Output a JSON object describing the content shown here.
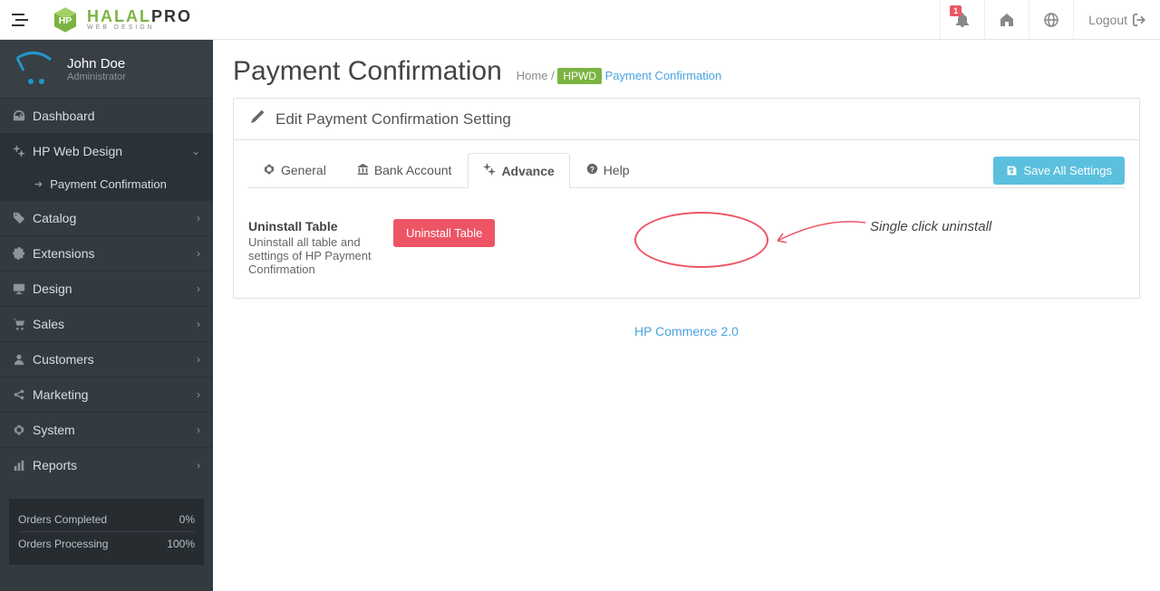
{
  "brand": {
    "main_a": "HALAL",
    "main_b": "PRO",
    "sub": "WEB DESIGN"
  },
  "topbar": {
    "notify_badge": "1",
    "logout": "Logout"
  },
  "user": {
    "name": "John Doe",
    "role": "Administrator"
  },
  "sidebar": {
    "items": [
      {
        "icon": "dashboard",
        "label": "Dashboard"
      },
      {
        "icon": "cogs",
        "label": "HP Web Design",
        "expanded": true,
        "children": [
          {
            "label": "Payment Confirmation"
          }
        ]
      },
      {
        "icon": "tags",
        "label": "Catalog",
        "chev": true
      },
      {
        "icon": "puzzle",
        "label": "Extensions",
        "chev": true
      },
      {
        "icon": "desktop",
        "label": "Design",
        "chev": true
      },
      {
        "icon": "cart",
        "label": "Sales",
        "chev": true
      },
      {
        "icon": "user",
        "label": "Customers",
        "chev": true
      },
      {
        "icon": "share",
        "label": "Marketing",
        "chev": true
      },
      {
        "icon": "cog",
        "label": "System",
        "chev": true
      },
      {
        "icon": "bars",
        "label": "Reports",
        "chev": true
      }
    ],
    "stats": [
      {
        "label": "Orders Completed",
        "value": "0%"
      },
      {
        "label": "Orders Processing",
        "value": "100%"
      }
    ]
  },
  "page": {
    "title": "Payment Confirmation",
    "breadcrumb": {
      "home": "Home",
      "tag": "HPWD",
      "current": "Payment Confirmation"
    }
  },
  "panel": {
    "title": "Edit Payment Confirmation Setting",
    "save": "Save All Settings",
    "tabs": [
      {
        "icon": "cog",
        "label": "General"
      },
      {
        "icon": "bank",
        "label": "Bank Account"
      },
      {
        "icon": "cogs",
        "label": "Advance",
        "active": true
      },
      {
        "icon": "help",
        "label": "Help"
      }
    ],
    "field": {
      "title": "Uninstall Table",
      "desc": "Uninstall all table and settings of HP Payment Confirmation",
      "button": "Uninstall Table"
    },
    "annot": "Single click uninstall"
  },
  "footer": {
    "link": "HP Commerce 2.0"
  }
}
